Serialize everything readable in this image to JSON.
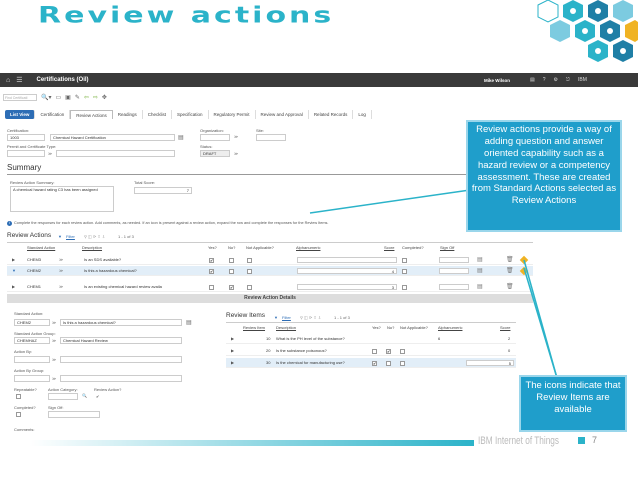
{
  "slide": {
    "title": "Review actions",
    "footer_brand": "IBM Internet of Things",
    "page_number": "7"
  },
  "app": {
    "title": "Certifications (Oil)",
    "user": "Mike Wilson",
    "brand": "IBM",
    "search_placeholder": "Find Certificati"
  },
  "tabs": [
    "List View",
    "Certification",
    "Review Actions",
    "Readings",
    "Checklist",
    "Specification",
    "Regulatory Permit",
    "Review and Approval",
    "Related Records",
    "Log"
  ],
  "header_fields": {
    "certification_label": "Certification:",
    "certification_value": "1003",
    "certification_desc": "Chemical Hazard Certification",
    "organization_label": "Organization:",
    "site_label": "Site:",
    "permit_label": "Permit and Certificate Type:",
    "status_label": "Status:",
    "status_value": "DRAFT"
  },
  "summary": {
    "title": "Summary",
    "ras_label": "Review Action Summary:",
    "ras_value": "A chemical hazard rating C3 has been assigned",
    "total_score_label": "Total Score:",
    "total_score_value": "7",
    "info_text": "Complete the responses for each review action. Add comments, as needed. If an icon is present against a review action, expand the row and complete the responses for the Review Items."
  },
  "review_actions": {
    "title": "Review Actions",
    "filter": "Filter",
    "pager": "1 - 1 of 3",
    "columns": [
      "Standard Action",
      "Description",
      "Yes?",
      "No?",
      "Not Applicable?",
      "Alphanumeric",
      "Score",
      "Completed?",
      "Sign Off"
    ],
    "rows": [
      {
        "action": "CHEM3",
        "desc": "Is an SDS available?",
        "yes": "✔",
        "no": "",
        "score": ""
      },
      {
        "action": "CHEM2",
        "desc": "Is this a hazardous chemical?",
        "yes": "✔",
        "no": "",
        "score": "4"
      },
      {
        "action": "CHEM1",
        "desc": "Is an existing chemical hazard review availa",
        "yes": "",
        "no": "✔",
        "score": "3"
      }
    ]
  },
  "details": {
    "title": "Review Action Details",
    "std_action_label": "Standard Action:",
    "std_action_value": "CHEM2",
    "std_action_desc": "Is this a hazardous chemical?",
    "std_group_label": "Standard Action Group:",
    "std_group_value": "CHEMHAZ",
    "std_group_desc": "Chemical Hazard Review",
    "action_by_label": "Action By:",
    "action_by_group_label": "Action By Group:",
    "repeatable_label": "Repeatable?",
    "category_label": "Action Category:",
    "review_action_label": "Review Action?",
    "completed_label": "Completed?",
    "signoff_label": "Sign Off:",
    "comments_label": "Comments:"
  },
  "review_items": {
    "title": "Review Items",
    "filter": "Filter",
    "pager": "1 - 1 of 3",
    "columns": [
      "Review Item",
      "Description",
      "Yes?",
      "No?",
      "Not Applicable?",
      "Alphanumeric",
      "Score"
    ],
    "rows": [
      {
        "num": "10",
        "desc": "What is the PH level of the substance?",
        "alpha": "6",
        "score": "2"
      },
      {
        "num": "20",
        "desc": "Is the substance poisonous?",
        "alpha": "",
        "score": "0"
      },
      {
        "num": "30",
        "desc": "Is the chemical for manufacturing use?",
        "alpha": "",
        "score": "5"
      }
    ]
  },
  "callouts": {
    "review_actions": "Review actions provide a way of adding question and answer oriented capability such as a hazard review or a competency assessment. These are created from Standard Actions selected as Review Actions",
    "icons": "The icons indicate that Review Items are available"
  },
  "colors": {
    "accent": "#2bb3c9",
    "callout": "#1f9ecb",
    "topbar": "#3a3a3a",
    "warning": "#f0b323"
  }
}
